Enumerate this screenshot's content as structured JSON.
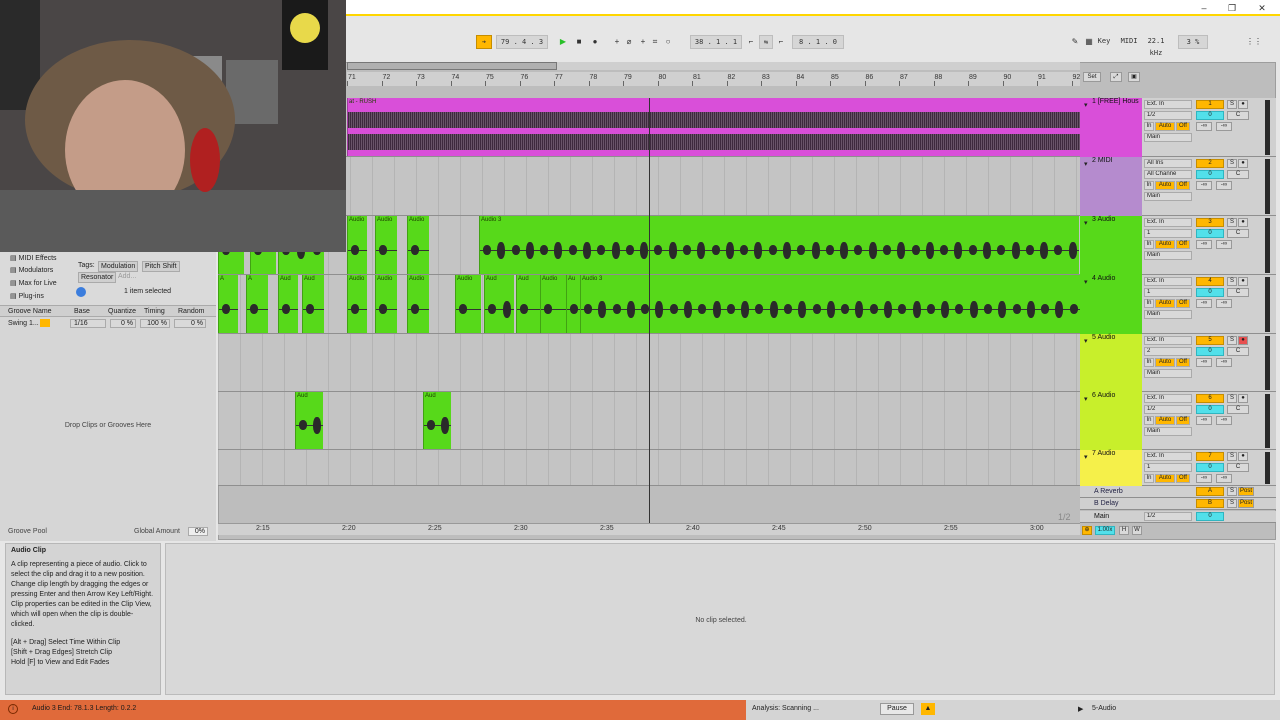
{
  "window": {
    "minimize": "–",
    "restore": "❐",
    "close": "✕"
  },
  "transport": {
    "follow_icon": "arrow-icon",
    "position": "79 .  4 .  3",
    "punch": "38 .  1 .  1",
    "loop_length": "8 .  1 .  0",
    "key": "Key",
    "midi": "MIDI",
    "sample_rate": "22.1 kHz",
    "cpu": "3 %"
  },
  "ruler": {
    "bars": [
      "71",
      "72",
      "73",
      "74",
      "75",
      "76",
      "77",
      "78",
      "79",
      "80",
      "81",
      "82",
      "83",
      "84",
      "85",
      "86",
      "87",
      "88",
      "89",
      "90",
      "91",
      "92"
    ],
    "set_label": "Set"
  },
  "time_ruler": [
    "2:15",
    "2:20",
    "2:25",
    "2:30",
    "2:35",
    "2:40",
    "2:45",
    "2:50",
    "2:55",
    "3:00"
  ],
  "tracks": [
    {
      "name": "1 [FREE] Hous",
      "input": "Ext. In",
      "channel": "1/2",
      "monitor": "Auto",
      "off": "Off",
      "out": "Main",
      "num": "1",
      "vol": "0",
      "pan": "C",
      "send": "-∞",
      "color": "#d94fd9"
    },
    {
      "name": "2 MIDI",
      "input": "All Ins",
      "channel": "All Channe",
      "monitor": "Auto",
      "off": "Off",
      "out": "Main",
      "num": "2",
      "vol": "0",
      "pan": "C",
      "send": "-∞",
      "color": "#b58bce"
    },
    {
      "name": "3 Audio",
      "input": "Ext. In",
      "channel": "1",
      "monitor": "Auto",
      "off": "Off",
      "out": "Main",
      "num": "3",
      "vol": "0",
      "pan": "C",
      "send": "-∞",
      "color": "#57d91a"
    },
    {
      "name": "4 Audio",
      "input": "Ext. In",
      "channel": "1",
      "monitor": "Auto",
      "off": "Off",
      "out": "Main",
      "num": "4",
      "vol": "0",
      "pan": "C",
      "send": "-∞",
      "color": "#57d91a"
    },
    {
      "name": "5 Audio",
      "input": "Ext. In",
      "channel": "2",
      "monitor": "Auto",
      "off": "Off",
      "out": "Main",
      "num": "5",
      "vol": "0",
      "pan": "C",
      "send": "-∞",
      "color": "#c8ef2b"
    },
    {
      "name": "6 Audio",
      "input": "Ext. In",
      "channel": "1/2",
      "monitor": "Auto",
      "off": "Off",
      "out": "Main",
      "num": "6",
      "vol": "0",
      "pan": "C",
      "send": "-∞",
      "color": "#c8ef2b"
    },
    {
      "name": "7 Audio",
      "input": "Ext. In",
      "channel": "1",
      "monitor": "Auto",
      "off": "Off",
      "out": "",
      "num": "7",
      "vol": "0",
      "pan": "C",
      "send": "-∞",
      "color": "#f5f04a"
    }
  ],
  "returns": [
    {
      "name": "A Reverb",
      "letter": "A",
      "post": "Post"
    },
    {
      "name": "B Delay",
      "letter": "B",
      "post": "Post"
    }
  ],
  "main": {
    "name": "Main",
    "channel": "1/2",
    "vol": "0",
    "page": "1/2"
  },
  "clips": {
    "track1_label": "at - RUSH",
    "audio": "Audio",
    "audio3": "Audio 3",
    "aud": "Aud",
    "au": "Au",
    "a": "A"
  },
  "browser": {
    "items": [
      "MIDI Effects",
      "Modulators",
      "Max for Live",
      "Plug-ins"
    ],
    "tags_label": "Tags:",
    "tag1": "Modulation",
    "tag2": "Pitch Shift",
    "tag3": "Resonator",
    "add": "Add...",
    "selected": "1 item selected"
  },
  "groove": {
    "headers": [
      "Groove Name",
      "Base",
      "Quantize",
      "Timing",
      "Random"
    ],
    "row": {
      "name": "Swing 1...",
      "base": "1/16",
      "quantize": "0 %",
      "timing": "100 %",
      "random": "0 %"
    },
    "drop": "Drop Clips or Grooves Here",
    "pool": "Groove Pool",
    "global_label": "Global Amount",
    "global_value": "0%"
  },
  "info": {
    "title": "Audio Clip",
    "body": "A clip representing a piece of audio. Click to select the clip and drag it to a new position. Change clip length by dragging the edges or pressing Enter and then Arrow Key Left/Right. Clip properties can be edited in the Clip View, which will open when the clip is double-clicked.",
    "hint1": "[Alt + Drag] Select Time Within Clip",
    "hint2": "[Shift + Drag Edges] Stretch Clip",
    "hint3": "Hold [F] to View and Edit Fades"
  },
  "detail": {
    "empty": "No clip selected."
  },
  "status": {
    "clip": "Audio 3  End: 78.1.3  Length: 0.2.2",
    "analysis": "Analysis: Scanning ...",
    "pause": "Pause",
    "track": "5-Audio"
  },
  "zoom": {
    "label": "1.00x",
    "h": "H",
    "w": "W"
  },
  "colors": {
    "purple": "#d94fd9",
    "green": "#57d91a",
    "lime": "#c8ef2b",
    "yellow": "#f5f04a",
    "orange": "#ffb700",
    "cyan": "#52e0ea",
    "accent": "#ffd600",
    "status": "#e06a3a"
  }
}
